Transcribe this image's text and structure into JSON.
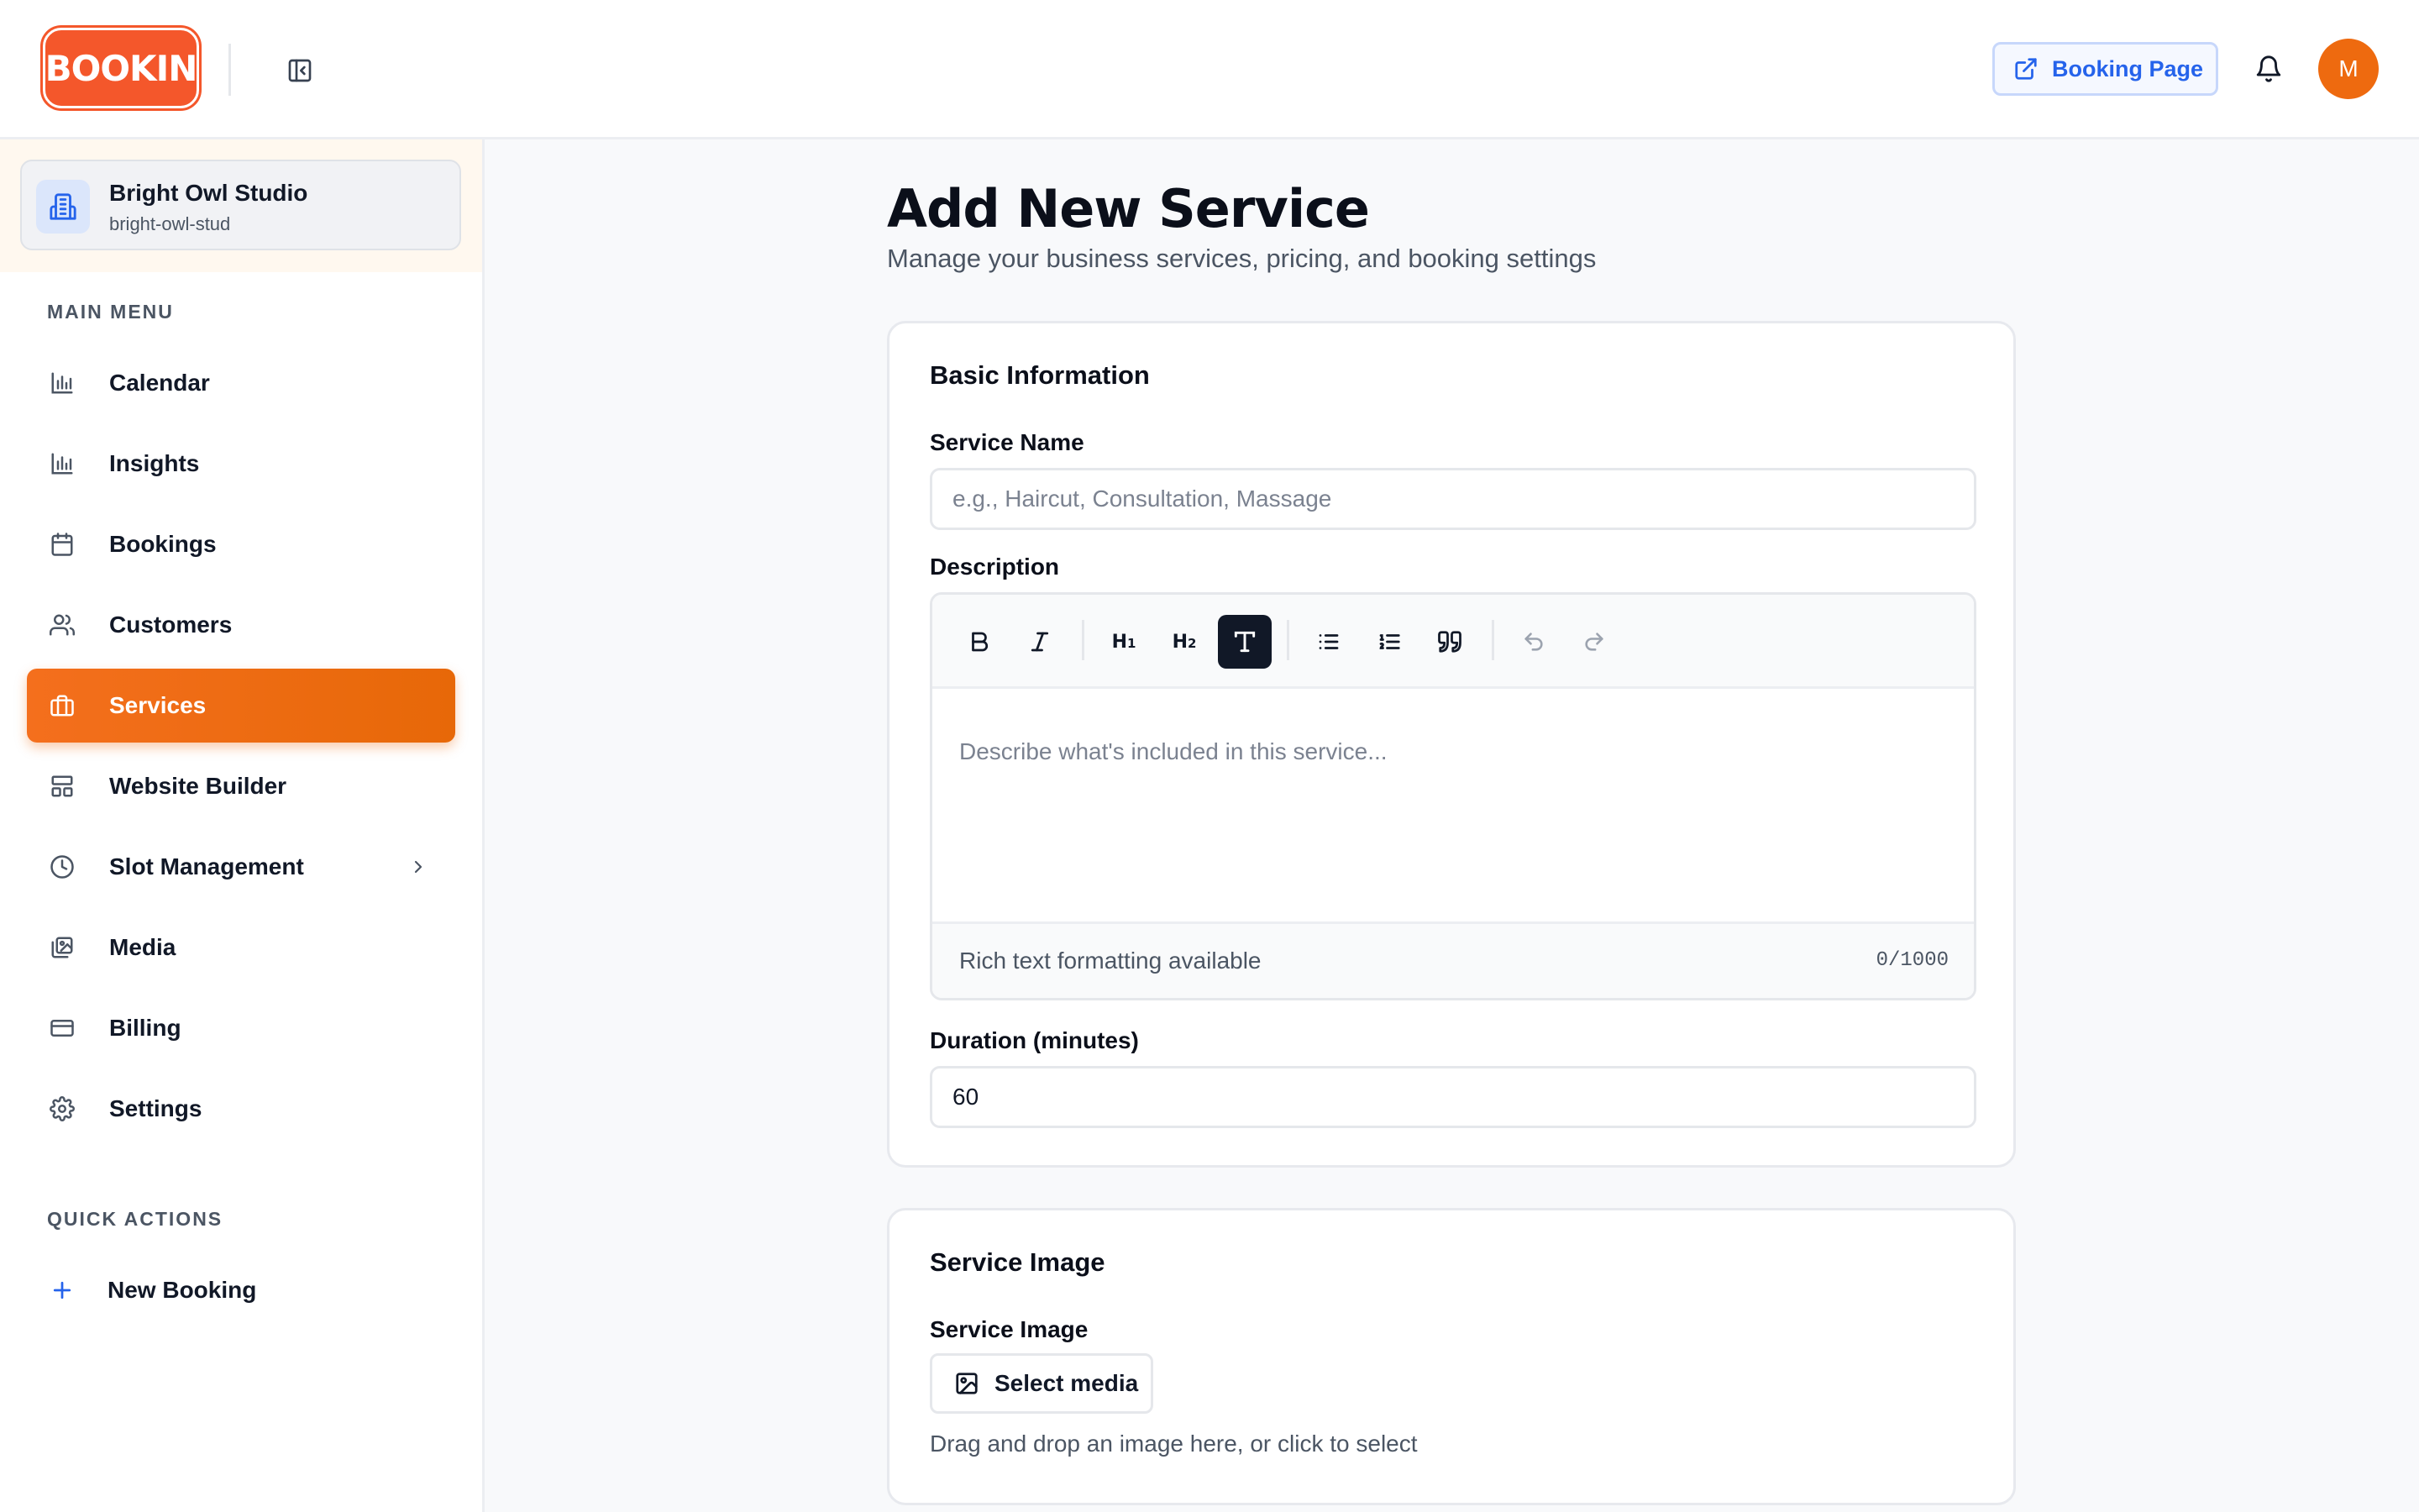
{
  "header": {
    "logo_text": "BOOKIN",
    "booking_page_label": "Booking Page",
    "avatar_initial": "M"
  },
  "sidebar": {
    "org": {
      "name": "Bright Owl Studio",
      "slug": "bright-owl-stud"
    },
    "main_menu_label": "MAIN MENU",
    "items": [
      {
        "label": "Calendar",
        "icon": "bar-chart-icon"
      },
      {
        "label": "Insights",
        "icon": "bar-chart-icon"
      },
      {
        "label": "Bookings",
        "icon": "calendar-icon"
      },
      {
        "label": "Customers",
        "icon": "users-icon"
      },
      {
        "label": "Services",
        "icon": "briefcase-icon",
        "active": true
      },
      {
        "label": "Website Builder",
        "icon": "layout-icon"
      },
      {
        "label": "Slot Management",
        "icon": "clock-icon"
      },
      {
        "label": "Media",
        "icon": "images-icon"
      },
      {
        "label": "Billing",
        "icon": "credit-card-icon"
      },
      {
        "label": "Settings",
        "icon": "gear-icon"
      }
    ],
    "quick_actions_label": "QUICK ACTIONS",
    "quick_actions": [
      {
        "label": "New Booking",
        "icon": "plus-icon"
      }
    ]
  },
  "main": {
    "title": "Add New Service",
    "subtitle": "Manage your business services, pricing, and booking settings",
    "basic_info": {
      "title": "Basic Information",
      "service_name_label": "Service Name",
      "service_name_placeholder": "e.g., Haircut, Consultation, Massage",
      "description_label": "Description",
      "description_placeholder": "Describe what's included in this service...",
      "editor_hint": "Rich text formatting available",
      "char_count": "0/1000",
      "duration_label": "Duration (minutes)",
      "duration_value": "60"
    },
    "service_image": {
      "title": "Service Image",
      "field_label": "Service Image",
      "select_media_label": "Select media",
      "hint": "Drag and drop an image here, or click to select"
    }
  },
  "colors": {
    "accent": "#f4572b",
    "active_nav": "#ee6c0f",
    "link_blue": "#2563eb"
  }
}
